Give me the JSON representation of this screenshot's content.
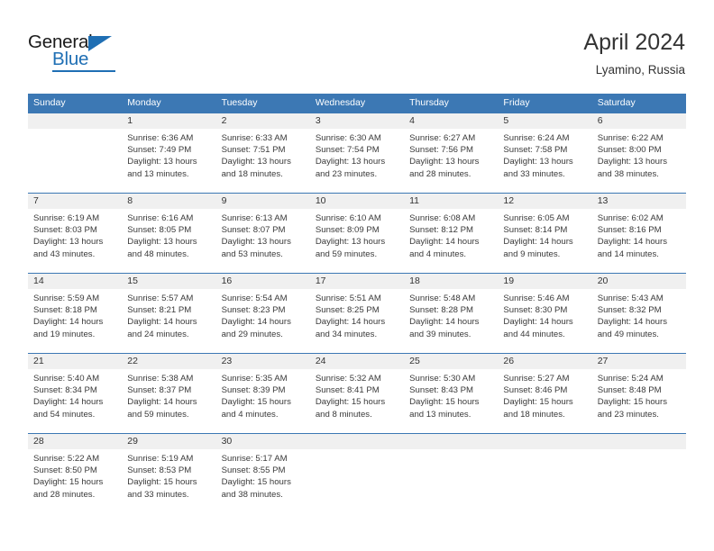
{
  "brand": {
    "name_top": "General",
    "name_bottom": "Blue",
    "triangle_icon": "blue-triangle-icon",
    "accent_color": "#1f6fb4"
  },
  "header": {
    "title": "April 2024",
    "subtitle": "Lyamino, Russia"
  },
  "theme": {
    "header_blue": "#3c78b4",
    "daynum_band": "#f0f0f0",
    "text": "#3a3a3a"
  },
  "calendar": {
    "weekday_headers": [
      "Sunday",
      "Monday",
      "Tuesday",
      "Wednesday",
      "Thursday",
      "Friday",
      "Saturday"
    ],
    "weeks": [
      [
        {
          "day": "",
          "lines": [
            "",
            "",
            "",
            ""
          ]
        },
        {
          "day": "1",
          "lines": [
            "Sunrise: 6:36 AM",
            "Sunset: 7:49 PM",
            "Daylight: 13 hours",
            "and 13 minutes."
          ]
        },
        {
          "day": "2",
          "lines": [
            "Sunrise: 6:33 AM",
            "Sunset: 7:51 PM",
            "Daylight: 13 hours",
            "and 18 minutes."
          ]
        },
        {
          "day": "3",
          "lines": [
            "Sunrise: 6:30 AM",
            "Sunset: 7:54 PM",
            "Daylight: 13 hours",
            "and 23 minutes."
          ]
        },
        {
          "day": "4",
          "lines": [
            "Sunrise: 6:27 AM",
            "Sunset: 7:56 PM",
            "Daylight: 13 hours",
            "and 28 minutes."
          ]
        },
        {
          "day": "5",
          "lines": [
            "Sunrise: 6:24 AM",
            "Sunset: 7:58 PM",
            "Daylight: 13 hours",
            "and 33 minutes."
          ]
        },
        {
          "day": "6",
          "lines": [
            "Sunrise: 6:22 AM",
            "Sunset: 8:00 PM",
            "Daylight: 13 hours",
            "and 38 minutes."
          ]
        }
      ],
      [
        {
          "day": "7",
          "lines": [
            "Sunrise: 6:19 AM",
            "Sunset: 8:03 PM",
            "Daylight: 13 hours",
            "and 43 minutes."
          ]
        },
        {
          "day": "8",
          "lines": [
            "Sunrise: 6:16 AM",
            "Sunset: 8:05 PM",
            "Daylight: 13 hours",
            "and 48 minutes."
          ]
        },
        {
          "day": "9",
          "lines": [
            "Sunrise: 6:13 AM",
            "Sunset: 8:07 PM",
            "Daylight: 13 hours",
            "and 53 minutes."
          ]
        },
        {
          "day": "10",
          "lines": [
            "Sunrise: 6:10 AM",
            "Sunset: 8:09 PM",
            "Daylight: 13 hours",
            "and 59 minutes."
          ]
        },
        {
          "day": "11",
          "lines": [
            "Sunrise: 6:08 AM",
            "Sunset: 8:12 PM",
            "Daylight: 14 hours",
            "and 4 minutes."
          ]
        },
        {
          "day": "12",
          "lines": [
            "Sunrise: 6:05 AM",
            "Sunset: 8:14 PM",
            "Daylight: 14 hours",
            "and 9 minutes."
          ]
        },
        {
          "day": "13",
          "lines": [
            "Sunrise: 6:02 AM",
            "Sunset: 8:16 PM",
            "Daylight: 14 hours",
            "and 14 minutes."
          ]
        }
      ],
      [
        {
          "day": "14",
          "lines": [
            "Sunrise: 5:59 AM",
            "Sunset: 8:18 PM",
            "Daylight: 14 hours",
            "and 19 minutes."
          ]
        },
        {
          "day": "15",
          "lines": [
            "Sunrise: 5:57 AM",
            "Sunset: 8:21 PM",
            "Daylight: 14 hours",
            "and 24 minutes."
          ]
        },
        {
          "day": "16",
          "lines": [
            "Sunrise: 5:54 AM",
            "Sunset: 8:23 PM",
            "Daylight: 14 hours",
            "and 29 minutes."
          ]
        },
        {
          "day": "17",
          "lines": [
            "Sunrise: 5:51 AM",
            "Sunset: 8:25 PM",
            "Daylight: 14 hours",
            "and 34 minutes."
          ]
        },
        {
          "day": "18",
          "lines": [
            "Sunrise: 5:48 AM",
            "Sunset: 8:28 PM",
            "Daylight: 14 hours",
            "and 39 minutes."
          ]
        },
        {
          "day": "19",
          "lines": [
            "Sunrise: 5:46 AM",
            "Sunset: 8:30 PM",
            "Daylight: 14 hours",
            "and 44 minutes."
          ]
        },
        {
          "day": "20",
          "lines": [
            "Sunrise: 5:43 AM",
            "Sunset: 8:32 PM",
            "Daylight: 14 hours",
            "and 49 minutes."
          ]
        }
      ],
      [
        {
          "day": "21",
          "lines": [
            "Sunrise: 5:40 AM",
            "Sunset: 8:34 PM",
            "Daylight: 14 hours",
            "and 54 minutes."
          ]
        },
        {
          "day": "22",
          "lines": [
            "Sunrise: 5:38 AM",
            "Sunset: 8:37 PM",
            "Daylight: 14 hours",
            "and 59 minutes."
          ]
        },
        {
          "day": "23",
          "lines": [
            "Sunrise: 5:35 AM",
            "Sunset: 8:39 PM",
            "Daylight: 15 hours",
            "and 4 minutes."
          ]
        },
        {
          "day": "24",
          "lines": [
            "Sunrise: 5:32 AM",
            "Sunset: 8:41 PM",
            "Daylight: 15 hours",
            "and 8 minutes."
          ]
        },
        {
          "day": "25",
          "lines": [
            "Sunrise: 5:30 AM",
            "Sunset: 8:43 PM",
            "Daylight: 15 hours",
            "and 13 minutes."
          ]
        },
        {
          "day": "26",
          "lines": [
            "Sunrise: 5:27 AM",
            "Sunset: 8:46 PM",
            "Daylight: 15 hours",
            "and 18 minutes."
          ]
        },
        {
          "day": "27",
          "lines": [
            "Sunrise: 5:24 AM",
            "Sunset: 8:48 PM",
            "Daylight: 15 hours",
            "and 23 minutes."
          ]
        }
      ],
      [
        {
          "day": "28",
          "lines": [
            "Sunrise: 5:22 AM",
            "Sunset: 8:50 PM",
            "Daylight: 15 hours",
            "and 28 minutes."
          ]
        },
        {
          "day": "29",
          "lines": [
            "Sunrise: 5:19 AM",
            "Sunset: 8:53 PM",
            "Daylight: 15 hours",
            "and 33 minutes."
          ]
        },
        {
          "day": "30",
          "lines": [
            "Sunrise: 5:17 AM",
            "Sunset: 8:55 PM",
            "Daylight: 15 hours",
            "and 38 minutes."
          ]
        },
        {
          "day": "",
          "lines": [
            "",
            "",
            "",
            ""
          ]
        },
        {
          "day": "",
          "lines": [
            "",
            "",
            "",
            ""
          ]
        },
        {
          "day": "",
          "lines": [
            "",
            "",
            "",
            ""
          ]
        },
        {
          "day": "",
          "lines": [
            "",
            "",
            "",
            ""
          ]
        }
      ]
    ]
  }
}
